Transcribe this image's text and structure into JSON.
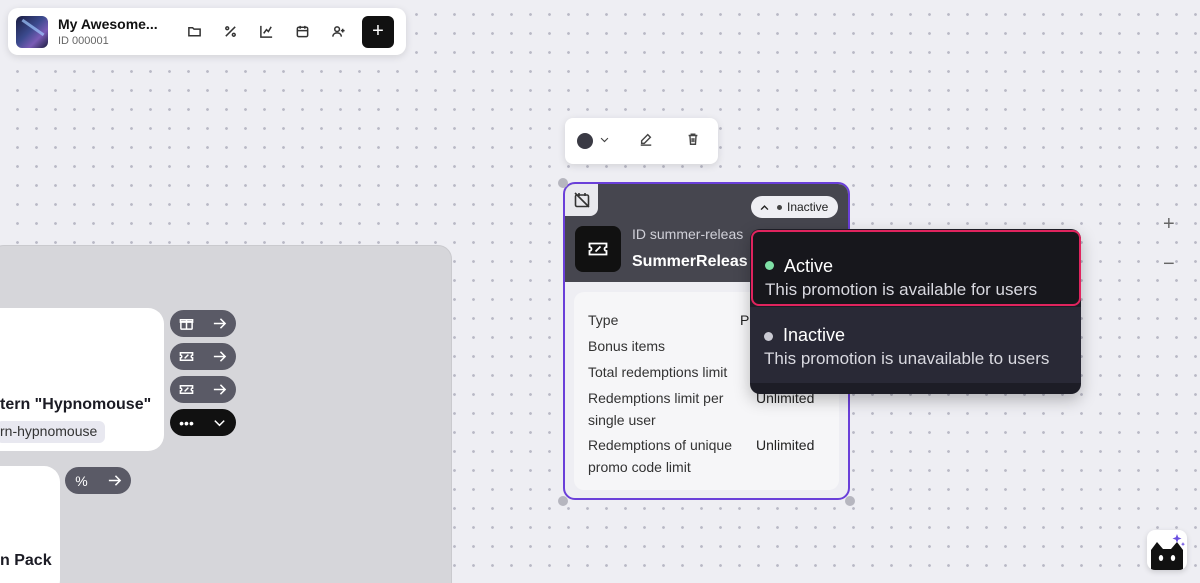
{
  "app": {
    "title": "My Awesome...",
    "id_label": "ID 000001",
    "toolbar_icons": [
      "folder-icon",
      "percent-icon",
      "chart-icon",
      "calendar-icon",
      "add-user-icon"
    ],
    "add_label": "+"
  },
  "left_panel": {
    "card_title": "tern \"Hypnomouse\"",
    "card_tag": "rn-hypnomouse",
    "card2_title": "n Pack",
    "node_buttons": [
      "gift-icon",
      "ticket-icon",
      "ticket-icon",
      "more-icon"
    ],
    "more_label": "•••",
    "percent_label": "%"
  },
  "mini_toolbar": {
    "color": "#3a3a44"
  },
  "promo": {
    "id_label": "ID summer-releas",
    "name": "SummerReleas",
    "status": "Inactive",
    "rows": [
      {
        "label": "Type",
        "value": "P"
      },
      {
        "label": "Bonus items",
        "value": ""
      },
      {
        "label": "Total redemptions limit",
        "value": ""
      },
      {
        "label": "Redemptions limit per single user",
        "value": "Unlimited"
      },
      {
        "label": "Redemptions of unique promo code limit",
        "value": "Unlimited"
      }
    ]
  },
  "dropdown": {
    "options": [
      {
        "title": "Active",
        "description": "This promotion is available for users",
        "dot_color": "#7fe0a6"
      },
      {
        "title": "Inactive",
        "description": "This promotion is unavailable to users",
        "dot_color": "#c9c9d2"
      }
    ]
  },
  "zoom": {
    "in": "+",
    "out": "−"
  },
  "colors": {
    "accent": "#6a3fd9",
    "highlight": "#e0245e"
  }
}
